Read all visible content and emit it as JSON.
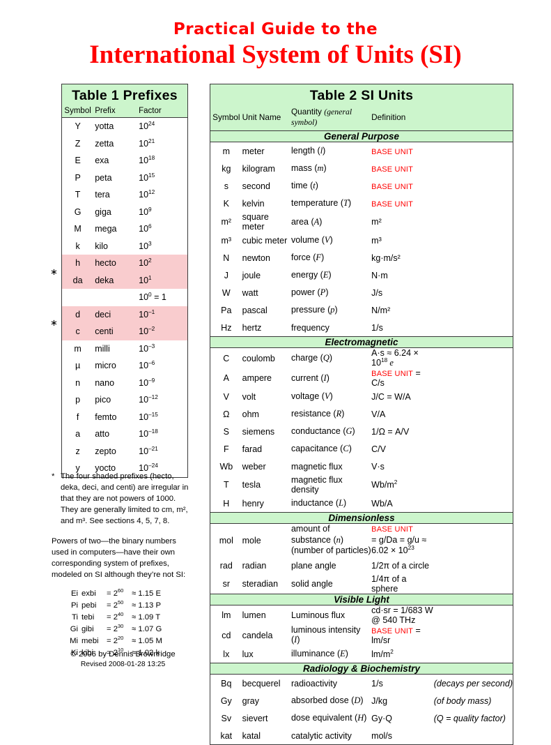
{
  "title": {
    "line1": "Practical Guide to the",
    "line2": "International System of Units (SI)",
    "color": "#ff0000"
  },
  "colors": {
    "header_green": "#ccf5cc",
    "shaded_pink": "#f9ccce",
    "base_unit_red": "#ff0000",
    "border": "#3a3a3a"
  },
  "table1": {
    "title": "Table 1  Prefixes",
    "columns": [
      "Symbol",
      "Prefix",
      "Factor"
    ],
    "rows": [
      {
        "symbol": "Y",
        "prefix": "yotta",
        "base": "10",
        "exp": "24",
        "shaded": false
      },
      {
        "symbol": "Z",
        "prefix": "zetta",
        "base": "10",
        "exp": "21",
        "shaded": false
      },
      {
        "symbol": "E",
        "prefix": "exa",
        "base": "10",
        "exp": "18",
        "shaded": false
      },
      {
        "symbol": "P",
        "prefix": "peta",
        "base": "10",
        "exp": "15",
        "shaded": false
      },
      {
        "symbol": "T",
        "prefix": "tera",
        "base": "10",
        "exp": "12",
        "shaded": false
      },
      {
        "symbol": "G",
        "prefix": "giga",
        "base": "10",
        "exp": "9",
        "shaded": false
      },
      {
        "symbol": "M",
        "prefix": "mega",
        "base": "10",
        "exp": "6",
        "shaded": false
      },
      {
        "symbol": "k",
        "prefix": "kilo",
        "base": "10",
        "exp": "3",
        "shaded": false
      },
      {
        "symbol": "h",
        "prefix": "hecto",
        "base": "10",
        "exp": "2",
        "shaded": true
      },
      {
        "symbol": "da",
        "prefix": "deka",
        "base": "10",
        "exp": "1",
        "shaded": true
      },
      {
        "symbol": "",
        "prefix": "",
        "base": "10",
        "exp": "0",
        "suffix": " = 1",
        "shaded": false
      },
      {
        "symbol": "d",
        "prefix": "deci",
        "base": "10",
        "exp": "–1",
        "shaded": true
      },
      {
        "symbol": "c",
        "prefix": "centi",
        "base": "10",
        "exp": "–2",
        "shaded": true
      },
      {
        "symbol": "m",
        "prefix": "milli",
        "base": "10",
        "exp": "–3",
        "shaded": false
      },
      {
        "symbol": "µ",
        "prefix": "micro",
        "base": "10",
        "exp": "–6",
        "shaded": false
      },
      {
        "symbol": "n",
        "prefix": "nano",
        "base": "10",
        "exp": "–9",
        "shaded": false
      },
      {
        "symbol": "p",
        "prefix": "pico",
        "base": "10",
        "exp": "–12",
        "shaded": false
      },
      {
        "symbol": "f",
        "prefix": "femto",
        "base": "10",
        "exp": "–15",
        "shaded": false
      },
      {
        "symbol": "a",
        "prefix": "atto",
        "base": "10",
        "exp": "–18",
        "shaded": false
      },
      {
        "symbol": "z",
        "prefix": "zepto",
        "base": "10",
        "exp": "–21",
        "shaded": false
      },
      {
        "symbol": "y",
        "prefix": "yocto",
        "base": "10",
        "exp": "–24",
        "shaded": false
      }
    ],
    "star_marker": "∗"
  },
  "notes": {
    "footnote_marker": "*",
    "footnote": "The four shaded prefixes (hecto, deka, deci, and centi) are irregular in that they are not powers of 1000. They are generally limited to cm, m², and m³. See sections 4, 5, 7, 8.",
    "binary_intro": "Powers of two—the binary numbers used in computers—have their own corresponding system of prefixes, modeled on SI although they’re not SI:",
    "binary_rows": [
      {
        "symbol": "Ei",
        "name": "exbi",
        "eq": "= 2",
        "exp": "60",
        "approx": "≈ 1.15 E"
      },
      {
        "symbol": "Pi",
        "name": "pebi",
        "eq": "= 2",
        "exp": "50",
        "approx": "≈ 1.13 P"
      },
      {
        "symbol": "Ti",
        "name": "tebi",
        "eq": "= 2",
        "exp": "40",
        "approx": "≈ 1.09 T"
      },
      {
        "symbol": "Gi",
        "name": "gibi",
        "eq": "= 2",
        "exp": "30",
        "approx": "≈ 1.07 G"
      },
      {
        "symbol": "Mi",
        "name": "mebi",
        "eq": "= 2",
        "exp": "20",
        "approx": "≈ 1.05 M"
      },
      {
        "symbol": "Ki",
        "name": "kibi",
        "eq": "= 2",
        "exp": "10",
        "approx": "≈ 1.02 k"
      }
    ]
  },
  "copyright": {
    "line1": "© 2006 by Dennis Brownridge",
    "line2": "Revised 2008-01-28 13:25"
  },
  "table2": {
    "title": "Table 2   SI Units",
    "columns": [
      "Symbol",
      "Unit Name",
      "Quantity (general symbol)",
      "Definition"
    ],
    "col_quantity_plain": "Quantity ",
    "col_quantity_italic": "(general symbol)",
    "base_unit_label": "BASE UNIT",
    "sections": [
      {
        "name": "General Purpose",
        "rows": [
          {
            "symbol": "m",
            "unit": "meter",
            "qty": "length ",
            "qsym": "l",
            "def_base": true,
            "def": ""
          },
          {
            "symbol": "kg",
            "unit": "kilogram",
            "qty": "mass ",
            "qsym": "m",
            "def_base": true,
            "def": ""
          },
          {
            "symbol": "s",
            "unit": "second",
            "qty": "time ",
            "qsym": "t",
            "def_base": true,
            "def": ""
          },
          {
            "symbol": "K",
            "unit": "kelvin",
            "qty": "temperature ",
            "qsym": "T",
            "def_base": true,
            "def": ""
          },
          {
            "symbol": "m²",
            "unit": "square meter",
            "qty": "area ",
            "qsym": "A",
            "def_base": false,
            "def": "m²"
          },
          {
            "symbol": "m³",
            "unit": "cubic meter",
            "qty": "volume ",
            "qsym": "V",
            "def_base": false,
            "def": "m³"
          },
          {
            "symbol": "N",
            "unit": "newton",
            "qty": "force ",
            "qsym": "F",
            "def_base": false,
            "def": "kg·m/s²"
          },
          {
            "symbol": "J",
            "unit": "joule",
            "qty": "energy ",
            "qsym": "E",
            "def_base": false,
            "def": "N·m"
          },
          {
            "symbol": "W",
            "unit": "watt",
            "qty": "power ",
            "qsym": "P",
            "def_base": false,
            "def": "J/s"
          },
          {
            "symbol": "Pa",
            "unit": "pascal",
            "qty": "pressure ",
            "qsym": "p",
            "def_base": false,
            "def": "N/m²"
          },
          {
            "symbol": "Hz",
            "unit": "hertz",
            "qty": "frequency",
            "qsym": "",
            "def_base": false,
            "def": "1/s"
          }
        ]
      },
      {
        "name": "Electromagnetic",
        "rows": [
          {
            "symbol": "C",
            "unit": "coulomb",
            "qty": "charge ",
            "qsym": "Q",
            "def_base": false,
            "def": "A·s ≈ 6.24 × 10",
            "def_exp": "18",
            "def_tail_italic": " e"
          },
          {
            "symbol": "A",
            "unit": "ampere",
            "qty": "current ",
            "qsym": "I",
            "def_base": true,
            "def": " = C/s"
          },
          {
            "symbol": "V",
            "unit": "volt",
            "qty": "voltage ",
            "qsym": "V",
            "def_base": false,
            "def": "J/C = W/A"
          },
          {
            "symbol": "Ω",
            "unit": "ohm",
            "qty": "resistance ",
            "qsym": "R",
            "def_base": false,
            "def": "V/A"
          },
          {
            "symbol": "S",
            "unit": "siemens",
            "qty": "conductance ",
            "qsym": "G",
            "def_base": false,
            "def": "1/Ω = A/V"
          },
          {
            "symbol": "F",
            "unit": "farad",
            "qty": "capacitance ",
            "qsym": "C",
            "def_base": false,
            "def": "C/V"
          },
          {
            "symbol": "Wb",
            "unit": "weber",
            "qty": "magnetic flux",
            "qsym": "",
            "def_base": false,
            "def": "V·s"
          },
          {
            "symbol": "T",
            "unit": "tesla",
            "qty": "magnetic flux density",
            "qsym": "",
            "def_base": false,
            "def": "Wb/m",
            "def_exp": "2"
          },
          {
            "symbol": "H",
            "unit": "henry",
            "qty": "inductance ",
            "qsym": "L",
            "def_base": false,
            "def": "Wb/A"
          }
        ]
      },
      {
        "name": "Dimensionless",
        "rows": [
          {
            "symbol": "mol",
            "unit": "mole",
            "qty": "amount of substance ",
            "qsym": "n",
            "qty_line2": "(number of particles)",
            "def_base": true,
            "def": "",
            "def_line2": "= g/Da = g/u ≈ 6.02 × 10",
            "def_line2_exp": "23",
            "two_line": true
          },
          {
            "symbol": "rad",
            "unit": "radian",
            "qty": "plane angle",
            "qsym": "",
            "def_base": false,
            "def": "1/2π of a circle"
          },
          {
            "symbol": "sr",
            "unit": "steradian",
            "qty": "solid angle",
            "qsym": "",
            "def_base": false,
            "def": "1/4π of a sphere"
          }
        ]
      },
      {
        "name": "Visible Light",
        "rows": [
          {
            "symbol": "lm",
            "unit": "lumen",
            "qty": "Luminous flux",
            "qsym": "",
            "def_base": false,
            "def": "cd·sr = 1/683 W @ 540 THz"
          },
          {
            "symbol": "cd",
            "unit": "candela",
            "qty": "luminous intensity ",
            "qsym": "I",
            "def_base": true,
            "def": " = lm/sr"
          },
          {
            "symbol": "lx",
            "unit": "lux",
            "qty": "illuminance ",
            "qsym": "E",
            "def_base": false,
            "def": "lm/m",
            "def_exp": "2"
          }
        ]
      },
      {
        "name": "Radiology & Biochemistry",
        "rows": [
          {
            "symbol": "Bq",
            "unit": "becquerel",
            "qty": "radioactivity",
            "qsym": "",
            "def_base": false,
            "def": "1/s",
            "note": "(decays per second)"
          },
          {
            "symbol": "Gy",
            "unit": "gray",
            "qty": "absorbed dose ",
            "qsym": "D",
            "def_base": false,
            "def": "J/kg",
            "note": "(of body mass)"
          },
          {
            "symbol": "Sv",
            "unit": "sievert",
            "qty": "dose equivalent ",
            "qsym": "H",
            "def_base": false,
            "def": "Gy·Q",
            "note": "(Q = quality factor)"
          },
          {
            "symbol": "kat",
            "unit": "katal",
            "qty": "catalytic activity",
            "qsym": "",
            "def_base": false,
            "def": "mol/s",
            "note": ""
          }
        ]
      }
    ]
  }
}
